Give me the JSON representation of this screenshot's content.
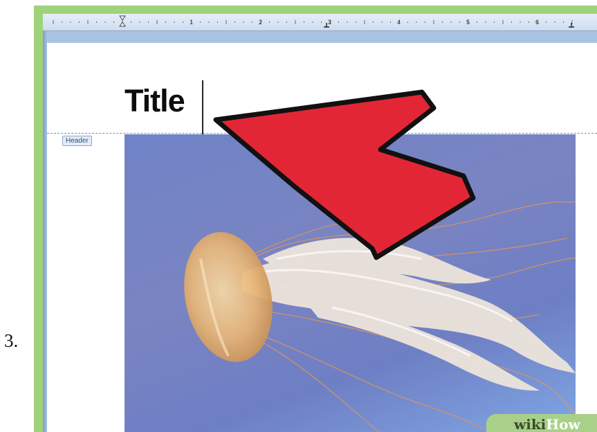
{
  "step": {
    "number": "3."
  },
  "ruler": {
    "labels": [
      "1",
      "2",
      "3",
      "4",
      "5",
      "6"
    ]
  },
  "document": {
    "title_text": "Title",
    "header_tag_label": "Header"
  },
  "photo": {
    "subject": "jellyfish"
  },
  "annotation": {
    "arrow_color": "#e32636",
    "arrow_icon": "arrow-up-left-icon"
  },
  "watermark": {
    "part1": "wiki",
    "part2": "How"
  },
  "colors": {
    "frame_green": "#9fd27a",
    "ruler_blue": "#cfdcee"
  }
}
